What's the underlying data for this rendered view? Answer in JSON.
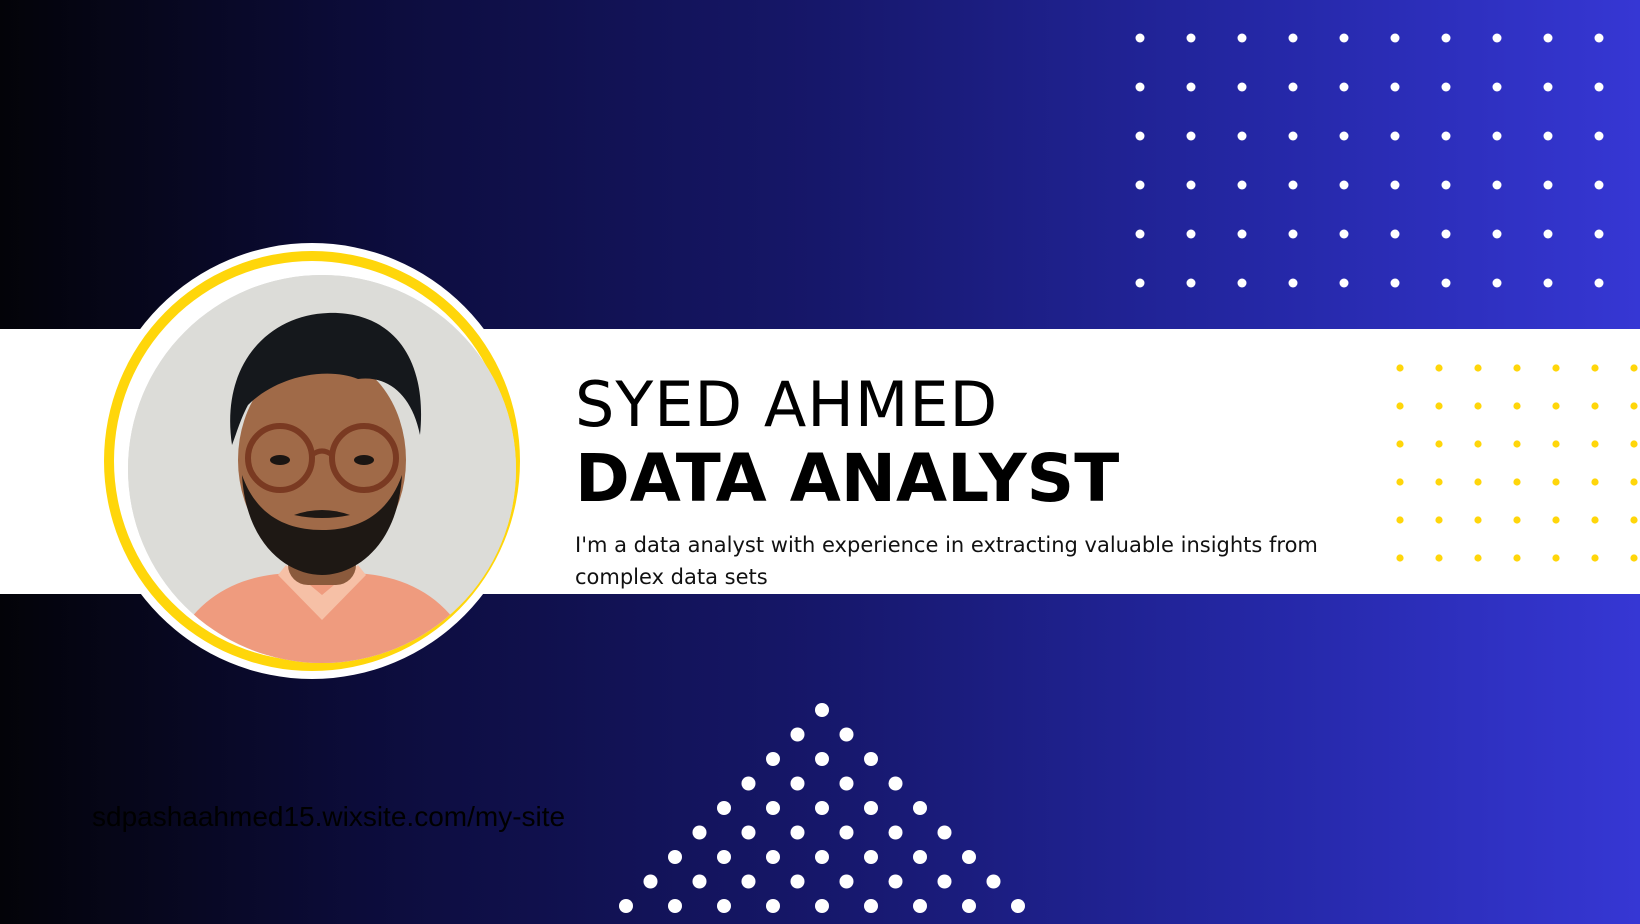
{
  "profile": {
    "name": "SYED AHMED",
    "role": "DATA ANALYST",
    "bio": "I'm a data analyst with experience in extracting valuable insights from complex data sets",
    "website": "sdpashaahmed15.wixsite.com/my-site"
  },
  "colors": {
    "accent_yellow": "#ffd60a",
    "band_white": "#ffffff",
    "gradient_dark": "#030308",
    "gradient_blue": "#3637d4"
  },
  "icons": {
    "white_dot_grid": "dot-grid",
    "yellow_dot_grid": "dot-grid",
    "dot_triangle": "dot-triangle"
  }
}
